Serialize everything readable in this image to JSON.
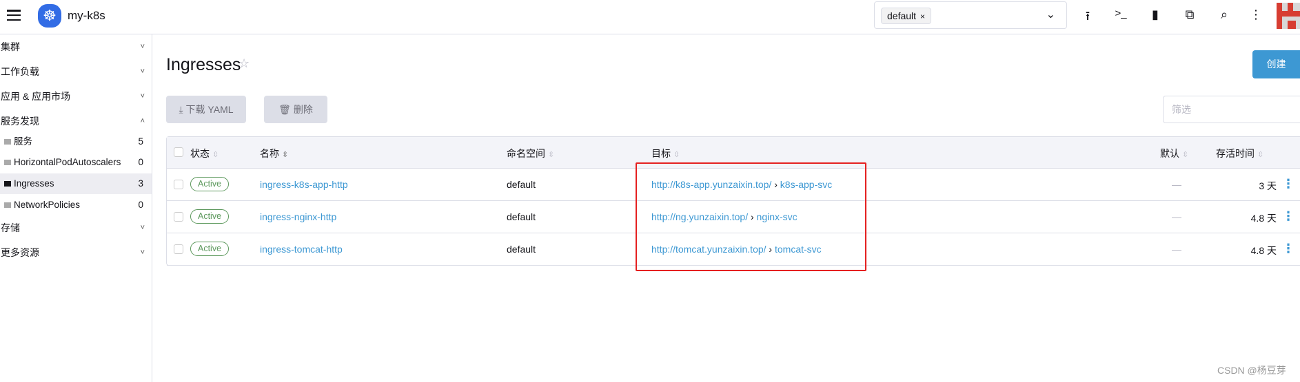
{
  "header": {
    "cluster_name": "my-k8s",
    "namespace_chip": "default",
    "chip_remove": "×",
    "dropdown": "⌄",
    "icons": [
      "upload-icon",
      "terminal-icon",
      "file-icon",
      "copy-config-icon",
      "search-icon",
      "more-icon"
    ]
  },
  "sidebar": {
    "groups": [
      {
        "label": "集群",
        "chev": "˅"
      },
      {
        "label": "工作负载",
        "chev": "˅"
      },
      {
        "label": "应用 & 应用市场",
        "chev": "˅"
      },
      {
        "label": "服务发现",
        "chev": "˄"
      },
      {
        "label": "存储",
        "chev": "˅"
      },
      {
        "label": "更多资源",
        "chev": "˅"
      }
    ],
    "items": [
      {
        "label": "服务",
        "count": "5"
      },
      {
        "label": "HorizontalPodAutoscalers",
        "count": "0"
      },
      {
        "label": "Ingresses",
        "count": "3",
        "selected": true
      },
      {
        "label": "NetworkPolicies",
        "count": "0"
      }
    ]
  },
  "page": {
    "title": "Ingresses",
    "create_label": "创建",
    "download_label": "下载 YAML",
    "delete_label": "删除",
    "filter_placeholder": "筛选"
  },
  "table": {
    "headers": {
      "state": "状态",
      "name": "名称",
      "namespace": "命名空间",
      "target": "目标",
      "default": "默认",
      "age": "存活时间"
    },
    "rows": [
      {
        "state": "Active",
        "name": "ingress-k8s-app-http",
        "namespace": "default",
        "url": "http://k8s-app.yunzaixin.top/",
        "arrow": "›",
        "service": "k8s-app-svc",
        "default": "—",
        "age": "3 天"
      },
      {
        "state": "Active",
        "name": "ingress-nginx-http",
        "namespace": "default",
        "url": "http://ng.yunzaixin.top/",
        "arrow": "›",
        "service": "nginx-svc",
        "default": "—",
        "age": "4.8 天"
      },
      {
        "state": "Active",
        "name": "ingress-tomcat-http",
        "namespace": "default",
        "url": "http://tomcat.yunzaixin.top/",
        "arrow": "›",
        "service": "tomcat-svc",
        "default": "—",
        "age": "4.8 天"
      }
    ]
  },
  "watermark": "CSDN @杨豆芽",
  "colors": {
    "accent": "#3d98d3",
    "active": "#5d995d",
    "highlight_box": "#e52020",
    "kubernetes": "#326ce5"
  }
}
